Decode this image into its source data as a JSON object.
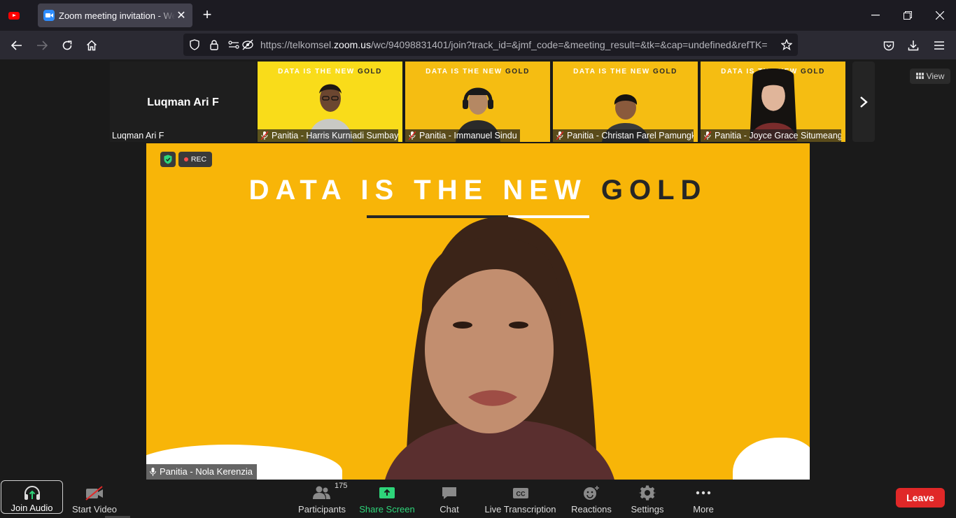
{
  "browser": {
    "tab_title": "Zoom meeting invitation - Web Client",
    "url_domain_prefix": "https://telkomsel.",
    "url_domain": "zoom.us",
    "url_path": "/wc/94098831401/join?track_id=&jmf_code=&meeting_result=&tk=&cap=undefined&refTK=",
    "pinned_tab_icon": "youtube-icon"
  },
  "gallery": {
    "self_name_large": "Luqman Ari F",
    "self_name_label": "Luqman Ari F",
    "banner_white": "DATA IS THE NEW ",
    "banner_dark": "GOLD",
    "participants": [
      {
        "name": "Panitia - Harris Kurniadi Sumbayak"
      },
      {
        "name": "Panitia - Immanuel Sindu"
      },
      {
        "name": "Panitia - Christan Farel Pamungkas"
      },
      {
        "name": "Panitia - Joyce Grace Situmeang"
      }
    ],
    "view_label": "View"
  },
  "main_video": {
    "banner_white": "DATA IS THE NEW ",
    "banner_dark": "GOLD",
    "rec_label": "REC",
    "speaker_name": "Panitia - Nola Kerenzia"
  },
  "toolbar": {
    "join_audio": "Join Audio",
    "start_video": "Start Video",
    "participants": "Participants",
    "participant_count": "175",
    "share_screen": "Share Screen",
    "chat": "Chat",
    "live_transcription": "Live Transcription",
    "reactions": "Reactions",
    "settings": "Settings",
    "more": "More",
    "leave": "Leave"
  },
  "colors": {
    "accent_yellow": "#f8b508",
    "leave_red": "#e02828",
    "share_green": "#2ed57a"
  }
}
